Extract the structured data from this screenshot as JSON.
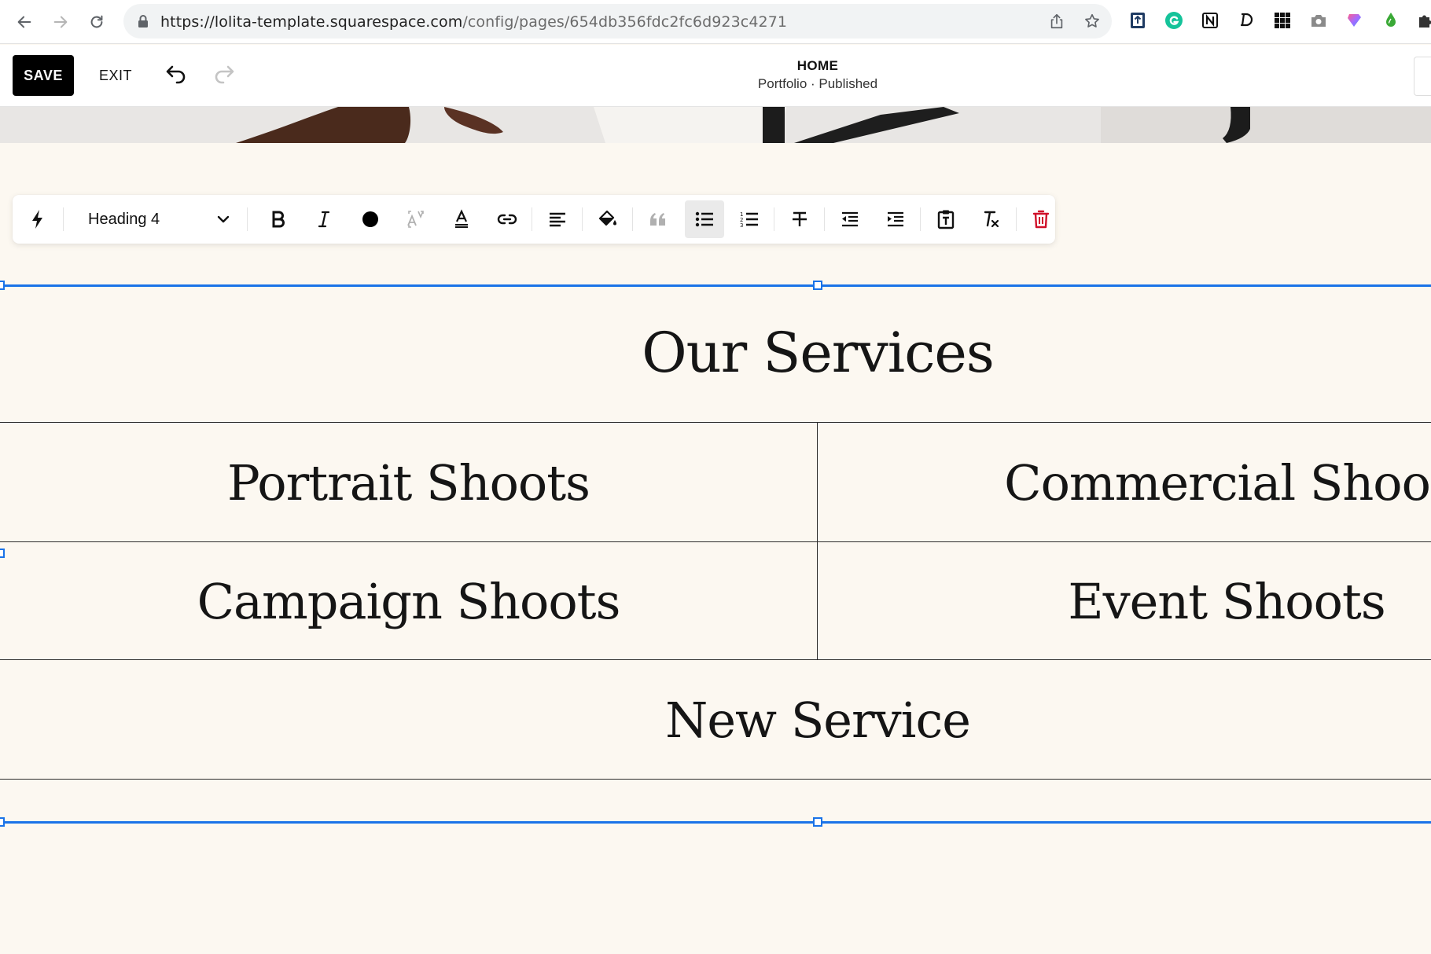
{
  "browser": {
    "url_host": "https://lolita-template.squarespace.com",
    "url_path": "/config/pages/654db356fdc2fc6d923c4271",
    "extensions": [
      "clipboard-icon",
      "grammarly-icon",
      "notion-icon",
      "d-extension-icon",
      "grid-apps-icon",
      "camera-icon",
      "gradient-extension-icon",
      "drop-icon",
      "puzzle-icon"
    ]
  },
  "editor": {
    "save_label": "SAVE",
    "exit_label": "EXIT",
    "page_title": "HOME",
    "page_subtitle": "Portfolio · Published"
  },
  "toolbar": {
    "style_value": "Heading 4",
    "delete_color": "#d0112b",
    "active_tool": "bulleted-list"
  },
  "content": {
    "heading": "Our Services",
    "services": [
      "Portrait Shoots",
      "Commercial Shoot",
      "Campaign Shoots",
      "Event Shoots",
      "New Service"
    ]
  },
  "colors": {
    "selection": "#1a73e8",
    "page_background": "#fcf8f1",
    "rule": "#2b2b2b"
  }
}
